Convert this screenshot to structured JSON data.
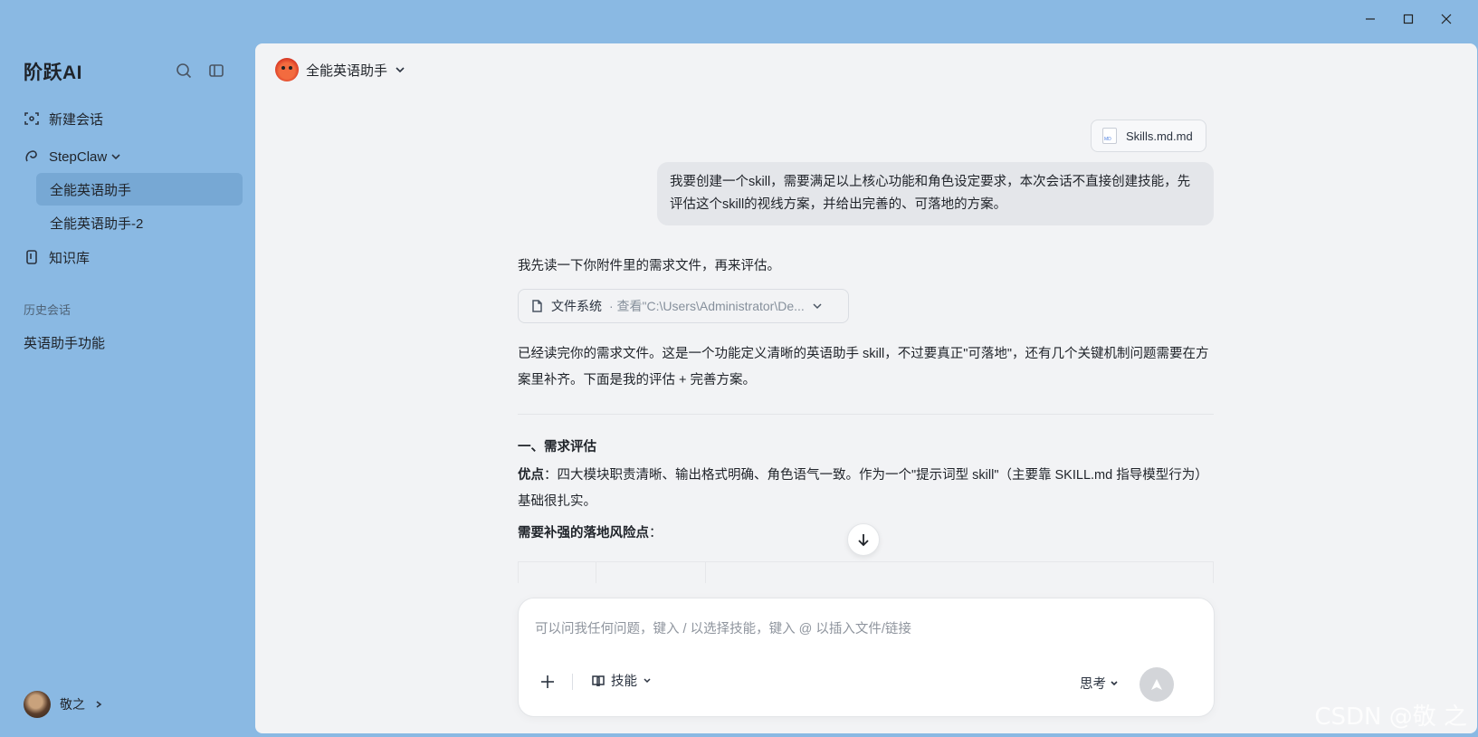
{
  "app": {
    "brand": "阶跃AI"
  },
  "sidebar": {
    "new_chat": "新建会话",
    "stepclaw": "StepClaw",
    "sub_items": [
      "全能英语助手",
      "全能英语助手-2"
    ],
    "knowledge": "知识库",
    "history_label": "历史会话",
    "history_items": [
      "英语助手功能"
    ],
    "user_name": "敬之"
  },
  "header": {
    "agent_name": "全能英语助手"
  },
  "conversation": {
    "attachment_name": "Skills.md.md",
    "user_message": "我要创建一个skill，需要满足以上核心功能和角色设定要求，本次会话不直接创建技能，先评估这个skill的视线方案，并给出完善的、可落地的方案。",
    "reply_intro": "我先读一下你附件里的需求文件，再来评估。",
    "tool_label": "文件系统",
    "tool_detail": "· 查看\"C:\\Users\\Administrator\\De...",
    "reply_summary": "已经读完你的需求文件。这是一个功能定义清晰的英语助手 skill，不过要真正\"可落地\"，还有几个关键机制问题需要在方案里补齐。下面是我的评估 + 完善方案。",
    "section_title": "一、需求评估",
    "strengths_label": "优点",
    "strengths_text": "：四大模块职责清晰、输出格式明确、角色语气一致。作为一个\"提示词型 skill\"（主要靠 SKILL.md 指导模型行为）基础很扎实。",
    "risks_label": "需要补强的落地风险点",
    "risks_suffix": "："
  },
  "composer": {
    "placeholder": "可以问我任何问题，键入 / 以选择技能，键入 @ 以插入文件/链接",
    "skills_label": "技能",
    "think_label": "思考"
  },
  "watermark": "CSDN @敬 之"
}
